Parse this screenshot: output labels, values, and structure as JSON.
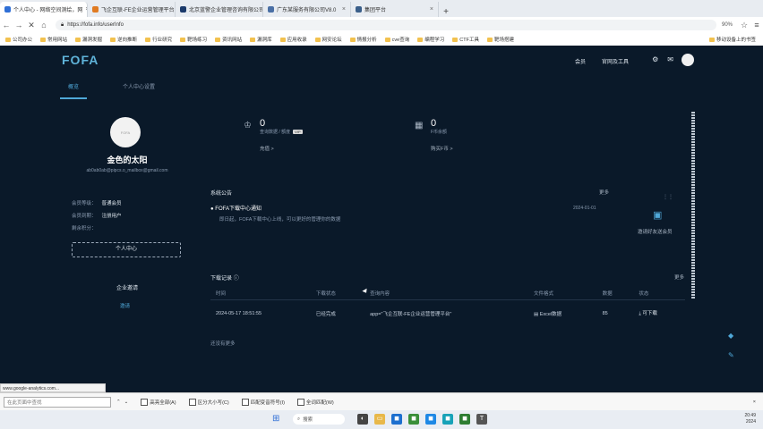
{
  "browser": {
    "tabs": [
      {
        "title": "个人中心 - 网络空间测绘，网",
        "active": true
      },
      {
        "title": "飞企互联-FE企业运营管理平台",
        "active": false
      },
      {
        "title": "北京蓝警企业管理咨询有限公司-V5",
        "active": false
      },
      {
        "title": "广东某服务有限公司V8.0",
        "active": false
      },
      {
        "title": "集团平台",
        "active": false
      }
    ],
    "url": "https://fofa.info/userInfo",
    "zoom": "90%",
    "bookmarks": [
      "公司办公",
      "常用网站",
      "漏洞发掘",
      "逆向推断",
      "行业研究",
      "靶场练习",
      "资讯网站",
      "漏洞库",
      "应用收录",
      "网安论坛",
      "情报分析",
      "cve查询",
      "编程学习",
      "CTF工具",
      "靶场搭建"
    ],
    "bookmarks_right": "移动设备上的书签"
  },
  "header": {
    "logo": "FOFA",
    "nav": [
      "会员",
      "官网及工具"
    ],
    "icons": [
      "bell-icon",
      "message-icon",
      "user-avatar"
    ]
  },
  "subtabs": [
    "概览",
    "个人中心设置"
  ],
  "profile": {
    "name": "金色的太阳",
    "email": "ab0ab0ab@pipcs.o_mailbox@gmail.com",
    "rows": [
      {
        "label": "会员等级：",
        "value": "普通会员"
      },
      {
        "label": "会员到期：",
        "value": "注册用户"
      },
      {
        "label": "剩余积分：",
        "value": ""
      }
    ],
    "button": "个人中心",
    "invite_title": "企业邀请",
    "invite_link": "邀请"
  },
  "stats": [
    {
      "num": "0",
      "label": "查询数据 / 额度",
      "tag": "VIP",
      "more": "充值 >"
    },
    {
      "num": "0",
      "label": "F币余额",
      "more": "购买F币 >"
    }
  ],
  "notices": {
    "title": "系统公告",
    "more": "更多",
    "item_title": "FOFA下载中心通知",
    "item_desc": "即日起，FOFA下载中心上线，可以更好的管理你的数据",
    "item_date": "2024-01-01",
    "side_label": "邀请好友送会员"
  },
  "downloads": {
    "title": "下载记录",
    "more": "更多",
    "columns": [
      "时间",
      "下载状态",
      "查询内容",
      "文件格式",
      "数据",
      "状态"
    ],
    "rows": [
      {
        "time": "2024-05-17 18:51:55",
        "status": "已经完成",
        "query": "app=\"飞企互联-FE企业运营管理平台\"",
        "format": "Excel数据",
        "count": "85",
        "action": "可下载"
      }
    ],
    "empty_label": "还没有更多"
  },
  "statusbar_url": "www.google-analytics.com...",
  "findbar": {
    "placeholder": "在此页面中查找",
    "options": [
      "高亮全部(A)",
      "区分大小写(C)",
      "匹配变音符号(I)",
      "全词匹配(W)"
    ]
  },
  "taskbar": {
    "search": "搜索",
    "time": "20:49",
    "date": "2024"
  }
}
